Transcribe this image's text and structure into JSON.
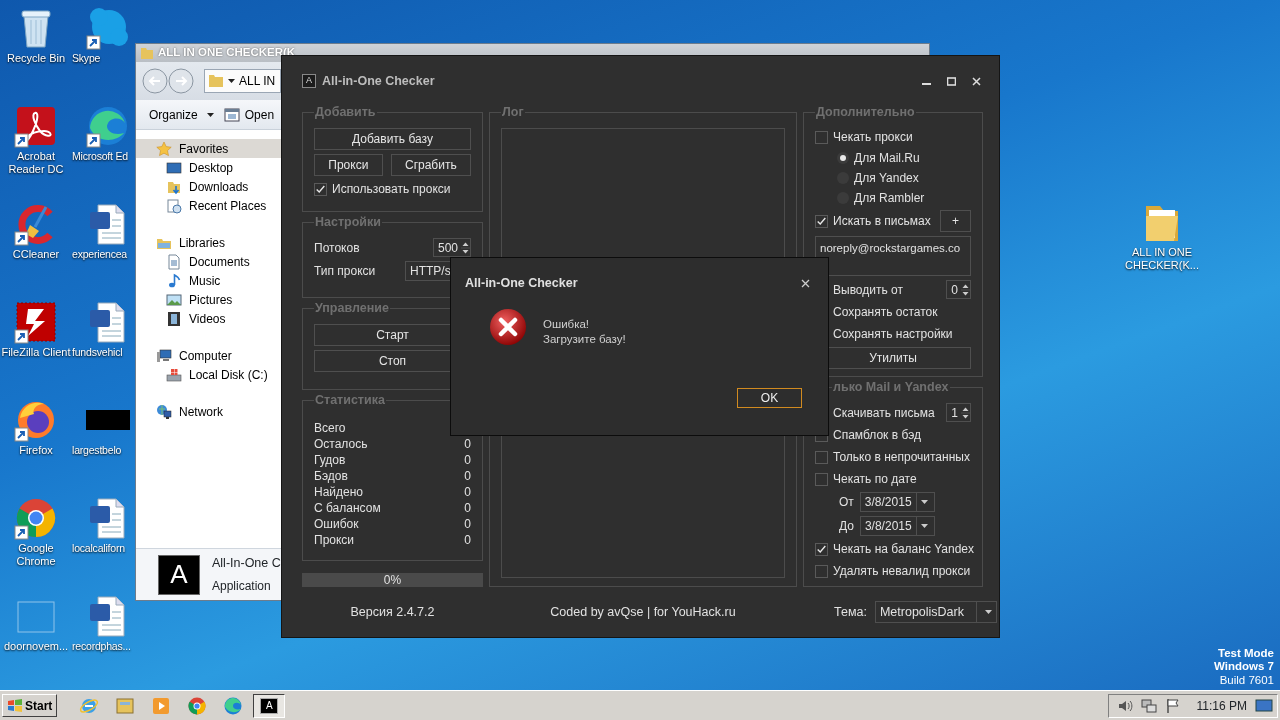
{
  "desktop_icons": [
    {
      "label": "Recycle Bin",
      "kind": "recycle",
      "shortcut": false
    },
    {
      "label": "Skype",
      "kind": "skype",
      "shortcut": true
    },
    {
      "label": "Acrobat Reader DC",
      "kind": "acrobat",
      "shortcut": true
    },
    {
      "label": "Microsoft Ed",
      "kind": "edge",
      "shortcut": true
    },
    {
      "label": "CCleaner",
      "kind": "ccleaner",
      "shortcut": true
    },
    {
      "label": "experiencea",
      "kind": "word",
      "shortcut": false
    },
    {
      "label": "FileZilla Client",
      "kind": "filezilla",
      "shortcut": true
    },
    {
      "label": "fundsvehicl",
      "kind": "word",
      "shortcut": false
    },
    {
      "label": "Firefox",
      "kind": "firefox",
      "shortcut": true
    },
    {
      "label": "largestbelo",
      "kind": "black",
      "shortcut": false
    },
    {
      "label": "Google Chrome",
      "kind": "chrome",
      "shortcut": true
    },
    {
      "label": "localcaliforn",
      "kind": "word",
      "shortcut": false
    },
    {
      "label": "doornovem...",
      "kind": "blank",
      "shortcut": false
    },
    {
      "label": "recordphas...",
      "kind": "word",
      "shortcut": false
    }
  ],
  "desktop_folder": {
    "label": "ALL IN ONE CHECKER(K..."
  },
  "explorer": {
    "title": "ALL IN ONE CHECKER(K",
    "address": "ALL IN",
    "toolbar": [
      {
        "label": "Organize",
        "kind": "menu"
      },
      {
        "label": "Open",
        "kind": "open"
      }
    ],
    "nav": [
      {
        "label": "Favorites",
        "kind": "star",
        "selected": true,
        "children": [
          {
            "label": "Desktop",
            "kind": "desktop",
            "selected": false
          },
          {
            "label": "Downloads",
            "kind": "downloads",
            "selected": false
          },
          {
            "label": "Recent Places",
            "kind": "recent",
            "selected": false
          }
        ]
      },
      {
        "label": "Libraries",
        "kind": "library",
        "selected": false,
        "children": [
          {
            "label": "Documents",
            "kind": "documents",
            "selected": false
          },
          {
            "label": "Music",
            "kind": "music",
            "selected": false
          },
          {
            "label": "Pictures",
            "kind": "pictures",
            "selected": false
          },
          {
            "label": "Videos",
            "kind": "videos",
            "selected": false
          }
        ]
      },
      {
        "label": "Computer",
        "kind": "computer",
        "selected": false,
        "children": [
          {
            "label": "Local Disk (C:)",
            "kind": "disk",
            "selected": false
          }
        ]
      },
      {
        "label": "Network",
        "kind": "network",
        "selected": false
      }
    ],
    "details": {
      "icon_text": "A",
      "name": "All-In-One C",
      "type": "Application"
    }
  },
  "checker": {
    "icon_text": "A",
    "title": "All-in-One Checker",
    "columns": [
      {
        "groups": [
          {
            "title": "Добавить",
            "controls": [
              {
                "kind": "button",
                "label": "Добавить базу"
              },
              {
                "kind": "buttons",
                "labels": [
                  "Прокси",
                  "Сграбить"
                ]
              },
              {
                "kind": "checkbox",
                "label": "Использовать прокси",
                "checked": true
              }
            ]
          },
          {
            "title": "Настройки",
            "controls": [
              {
                "kind": "spinner",
                "label": "Потоков",
                "value": "500"
              },
              {
                "kind": "combo",
                "label": "Тип прокси",
                "value": "HTTP/s"
              }
            ]
          },
          {
            "title": "Управление",
            "controls": [
              {
                "kind": "button",
                "label": "Старт"
              },
              {
                "kind": "button",
                "label": "Стоп"
              }
            ]
          },
          {
            "title": "Статистика",
            "controls": [
              {
                "kind": "stat",
                "label": "Всего"
              },
              {
                "kind": "stat",
                "label": "Осталось",
                "value": "0"
              },
              {
                "kind": "stat",
                "label": "Гудов",
                "value": "0"
              },
              {
                "kind": "stat",
                "label": "Бэдов",
                "value": "0"
              },
              {
                "kind": "stat",
                "label": "Найдено",
                "value": "0"
              },
              {
                "kind": "stat",
                "label": "С балансом",
                "value": "0"
              },
              {
                "kind": "stat",
                "label": "Ошибок",
                "value": "0"
              },
              {
                "kind": "stat",
                "label": "Прокси",
                "value": "0"
              }
            ]
          }
        ]
      },
      {
        "groups": [
          {
            "title": "Лог",
            "controls": [
              {
                "kind": "log"
              }
            ]
          }
        ]
      },
      {
        "groups": [
          {
            "title": "Дополнительно",
            "controls": [
              {
                "kind": "checkbox",
                "label": "Чекать прокси",
                "checked": false
              },
              {
                "kind": "radio",
                "label": "Для Mail.Ru",
                "selected": true
              },
              {
                "kind": "radio",
                "label": "Для Yandex",
                "selected": false
              },
              {
                "kind": "radio",
                "label": "Для Rambler",
                "selected": false
              },
              {
                "kind": "checkbox",
                "label": "Искать в письмах",
                "checked": true,
                "button": "+"
              },
              {
                "kind": "textarea",
                "value": "noreply@rockstargames.co"
              },
              {
                "kind": "spinner",
                "label": "Выводить от",
                "value": "0"
              },
              {
                "kind": "text",
                "label": "Сохранять остаток"
              },
              {
                "kind": "text",
                "label": "Сохранять настройки"
              },
              {
                "kind": "button",
                "label": "Утилиты"
              }
            ]
          },
          {
            "title": "лько Mail и Yandex",
            "controls": [
              {
                "kind": "spinner",
                "label": "Скачивать письма",
                "value": "1"
              },
              {
                "kind": "checkbox",
                "label": "Спамблок в бэд",
                "checked": false
              },
              {
                "kind": "checkbox",
                "label": "Только в непрочитанных",
                "checked": false
              },
              {
                "kind": "checkbox",
                "label": "Чекать по дате",
                "checked": false
              },
              {
                "kind": "date",
                "label": "От",
                "value": "3/8/2015"
              },
              {
                "kind": "date",
                "label": "До",
                "value": "3/8/2015"
              },
              {
                "kind": "checkbox",
                "label": "Чекать на баланс Yandex",
                "checked": true
              },
              {
                "kind": "checkbox",
                "label": "Удалять невалид прокси",
                "checked": false
              }
            ]
          }
        ]
      }
    ],
    "progress": {
      "level": 0,
      "label": "0%"
    },
    "footer": {
      "version": "Версия 2.4.7.2",
      "credit": "Coded by avQse | for YouHack.ru",
      "theme_label": "Тема:",
      "theme": "MetropolisDark"
    }
  },
  "dialog": {
    "title": "All-in-One Checker",
    "message": [
      "Ошибка!",
      "Загрузите базу!"
    ],
    "button": {
      "label": "OK",
      "focused": true
    }
  },
  "os_notice": [
    "Test Mode",
    "Windows 7",
    "Build 7601"
  ],
  "taskbar": {
    "start": "Start",
    "apps": [
      {
        "kind": "ie",
        "active": false
      },
      {
        "kind": "explorer",
        "active": false
      },
      {
        "kind": "media",
        "active": false
      },
      {
        "kind": "chrome",
        "active": false
      },
      {
        "kind": "edge",
        "active": false
      },
      {
        "kind": "checker",
        "active": true,
        "icon_text": "A"
      }
    ],
    "clock": "11:16 PM"
  }
}
